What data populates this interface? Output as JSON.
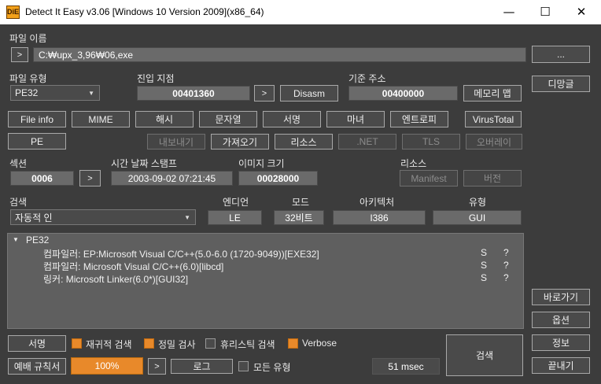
{
  "window": {
    "title": "Detect It Easy v3.06 [Windows 10 Version 2009](x86_64)",
    "icon_text": "DiE",
    "minimize_glyph": "—",
    "maximize_glyph": "☐",
    "close_glyph": "✕"
  },
  "file": {
    "label": "파일 이름",
    "path": "C:₩upx_3,96₩06,exe",
    "browse_label": "...",
    "open_arrow": ">"
  },
  "filetype": {
    "label": "파일 유형",
    "value": "PE32"
  },
  "entry": {
    "label": "진입 지점",
    "value": "00401360",
    "arrow": ">",
    "disasm_label": "Disasm"
  },
  "base": {
    "label": "기준 주소",
    "value": "00400000",
    "memmap_label": "메모리 맵"
  },
  "demangle_label": "디망글",
  "buttons_row1": [
    "File info",
    "MIME",
    "해시",
    "문자열",
    "서명",
    "마녀",
    "엔트로피",
    "VirusTotal"
  ],
  "pe_label": "PE",
  "buttons_row2": {
    "export": "내보내기",
    "import": "가져오기",
    "resources": "리소스",
    "net": ".NET",
    "tls": "TLS",
    "overlay": "오버레이"
  },
  "section": {
    "label": "섹션",
    "value": "0006",
    "arrow": ">"
  },
  "timestamp": {
    "label": "시간 날짜 스탬프",
    "value": "2003-09-02 07:21:45"
  },
  "imagesize": {
    "label": "이미지 크기",
    "value": "00028000"
  },
  "resources": {
    "label": "리소스",
    "manifest_label": "Manifest",
    "version_label": "버전"
  },
  "scan": {
    "label": "검색",
    "mode_value": "자동적 인"
  },
  "endian": {
    "label": "엔디언",
    "value": "LE"
  },
  "mode": {
    "label": "모드",
    "value": "32비트"
  },
  "arch": {
    "label": "아키텍처",
    "value": "I386"
  },
  "type": {
    "label": "유형",
    "value": "GUI"
  },
  "results": {
    "root": "PE32",
    "expand_glyph": "▼",
    "rows": [
      {
        "text": "컴파일러: EP:Microsoft Visual C/C++(5.0-6.0 (1720-9049))[EXE32]",
        "s": "S",
        "q": "?"
      },
      {
        "text": "컴파일러: Microsoft Visual C/C++(6.0)[libcd]",
        "s": "S",
        "q": "?"
      },
      {
        "text": "링커: Microsoft Linker(6.0*)[GUI32]",
        "s": "S",
        "q": "?"
      }
    ]
  },
  "side": {
    "shortcuts": "바로가기",
    "options": "옵션",
    "about": "정보",
    "exit": "끝내기"
  },
  "bottom": {
    "signatures": "서명",
    "recursive": {
      "label": "재귀적 검색",
      "checked": true
    },
    "deep": {
      "label": "정밀 검사",
      "checked": true
    },
    "heuristic": {
      "label": "휴리스틱 검색",
      "checked": false
    },
    "verbose": {
      "label": "Verbose",
      "checked": true
    },
    "rules": "예배 규칙서",
    "progress": "100%",
    "progress_arrow": ">",
    "log": "로그",
    "alltypes": {
      "label": "모든 유형",
      "checked": false
    },
    "elapsed": "51 msec",
    "scan_button": "검색"
  },
  "colors": {
    "background": "#3c3c3c",
    "accent": "#e8892a",
    "field": "#6a6a6a"
  }
}
